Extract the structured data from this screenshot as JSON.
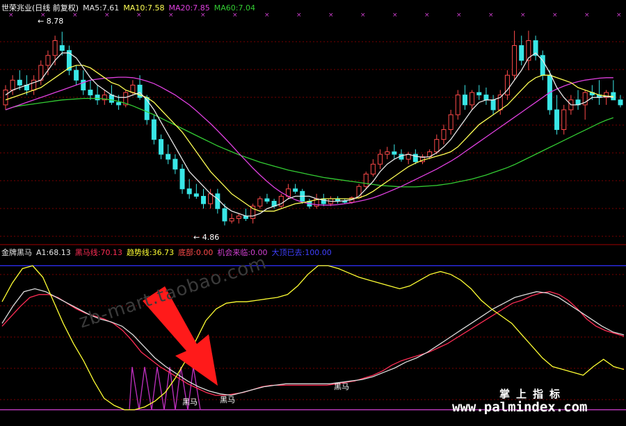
{
  "colors": {
    "up": "#ff4a4a",
    "down": "#39e6e6",
    "ma5": "#e8e8e8",
    "ma10": "#ffff55",
    "ma20": "#e040e0",
    "ma60": "#33cc33",
    "grid": "#7a0000",
    "red": "#ff2d55",
    "white": "#dddddd",
    "yellow": "#ffff33",
    "magenta": "#d040d0",
    "blue": "#3030ff"
  },
  "header": {
    "title": "世荣兆业(日线 前复权)",
    "ma5": "MA5:7.61",
    "ma10": "MA10:7.58",
    "ma20": "MA20:7.85",
    "ma60": "MA60:7.04"
  },
  "price_labels": {
    "high": "8.78",
    "low": "4.86"
  },
  "indicator": {
    "name": "金牌黑马",
    "a1": "A1:68.13",
    "heima_line": "黑马线:70.13",
    "trend_line": "趋势线:36.73",
    "bottom": "底部:0.00",
    "chance": "机会来临:0.00",
    "top_passed": "大顶已去:100.00"
  },
  "signals": {
    "s1": "黑马",
    "s2": "黑马",
    "s3": "黑马"
  },
  "watermark": "zb-mart.taobao.com",
  "brand": {
    "cn": "掌上指标",
    "url": "www.palmindex.com"
  },
  "chart_data": [
    {
      "type": "candlestick",
      "title": "世荣兆业(日线 前复权)",
      "ohlc": [
        [
          7.3,
          7.7,
          7.2,
          7.6
        ],
        [
          7.6,
          7.9,
          7.5,
          7.8
        ],
        [
          7.8,
          8.0,
          7.6,
          7.7
        ],
        [
          7.7,
          7.9,
          7.5,
          7.6
        ],
        [
          7.6,
          7.9,
          7.5,
          7.8
        ],
        [
          7.8,
          8.2,
          7.7,
          8.1
        ],
        [
          8.1,
          8.4,
          7.9,
          8.3
        ],
        [
          8.3,
          8.7,
          8.1,
          8.6
        ],
        [
          8.5,
          8.78,
          8.3,
          8.4
        ],
        [
          8.4,
          8.5,
          7.9,
          8.0
        ],
        [
          8.0,
          8.1,
          7.7,
          7.8
        ],
        [
          7.8,
          8.0,
          7.5,
          7.6
        ],
        [
          7.6,
          7.8,
          7.4,
          7.5
        ],
        [
          7.5,
          7.7,
          7.3,
          7.4
        ],
        [
          7.4,
          7.6,
          7.3,
          7.5
        ],
        [
          7.5,
          7.7,
          7.3,
          7.35
        ],
        [
          7.35,
          7.5,
          7.2,
          7.3
        ],
        [
          7.3,
          7.6,
          7.25,
          7.55
        ],
        [
          7.55,
          7.8,
          7.5,
          7.7
        ],
        [
          7.7,
          7.9,
          7.4,
          7.45
        ],
        [
          7.45,
          7.5,
          6.9,
          7.0
        ],
        [
          7.0,
          7.1,
          6.5,
          6.6
        ],
        [
          6.6,
          6.7,
          6.2,
          6.3
        ],
        [
          6.3,
          6.5,
          6.1,
          6.2
        ],
        [
          6.2,
          6.3,
          5.9,
          6.0
        ],
        [
          6.0,
          6.1,
          5.5,
          5.6
        ],
        [
          5.6,
          5.8,
          5.4,
          5.5
        ],
        [
          5.5,
          5.7,
          5.4,
          5.45
        ],
        [
          5.45,
          5.6,
          5.2,
          5.3
        ],
        [
          5.3,
          5.6,
          5.2,
          5.5
        ],
        [
          5.5,
          5.6,
          5.1,
          5.2
        ],
        [
          5.2,
          5.3,
          4.86,
          4.95
        ],
        [
          4.95,
          5.1,
          4.9,
          5.0
        ],
        [
          5.0,
          5.1,
          4.9,
          5.05
        ],
        [
          5.05,
          5.2,
          4.95,
          5.0
        ],
        [
          5.0,
          5.3,
          4.9,
          5.25
        ],
        [
          5.25,
          5.45,
          5.2,
          5.4
        ],
        [
          5.4,
          5.5,
          5.3,
          5.35
        ],
        [
          5.35,
          5.4,
          5.2,
          5.25
        ],
        [
          5.25,
          5.5,
          5.2,
          5.45
        ],
        [
          5.45,
          5.7,
          5.4,
          5.6
        ],
        [
          5.6,
          5.7,
          5.5,
          5.55
        ],
        [
          5.55,
          5.6,
          5.3,
          5.35
        ],
        [
          5.35,
          5.4,
          5.2,
          5.25
        ],
        [
          5.25,
          5.5,
          5.2,
          5.4
        ],
        [
          5.4,
          5.5,
          5.25,
          5.3
        ],
        [
          5.3,
          5.45,
          5.25,
          5.4
        ],
        [
          5.4,
          5.45,
          5.3,
          5.35
        ],
        [
          5.35,
          5.4,
          5.3,
          5.33
        ],
        [
          5.33,
          5.45,
          5.3,
          5.42
        ],
        [
          5.42,
          5.7,
          5.4,
          5.65
        ],
        [
          5.65,
          5.95,
          5.6,
          5.9
        ],
        [
          5.9,
          6.2,
          5.85,
          6.1
        ],
        [
          6.1,
          6.4,
          6.0,
          6.3
        ],
        [
          6.3,
          6.45,
          6.2,
          6.35
        ],
        [
          6.35,
          6.5,
          6.2,
          6.3
        ],
        [
          6.3,
          6.4,
          6.15,
          6.2
        ],
        [
          6.2,
          6.35,
          6.1,
          6.3
        ],
        [
          6.3,
          6.4,
          6.1,
          6.15
        ],
        [
          6.15,
          6.3,
          6.1,
          6.25
        ],
        [
          6.25,
          6.4,
          6.2,
          6.35
        ],
        [
          6.35,
          6.7,
          6.3,
          6.6
        ],
        [
          6.6,
          6.9,
          6.5,
          6.8
        ],
        [
          6.8,
          7.2,
          6.7,
          7.1
        ],
        [
          7.1,
          7.6,
          7.0,
          7.5
        ],
        [
          7.5,
          7.7,
          7.2,
          7.3
        ],
        [
          7.3,
          7.6,
          7.2,
          7.55
        ],
        [
          7.55,
          7.7,
          7.4,
          7.5
        ],
        [
          7.5,
          7.65,
          7.3,
          7.4
        ],
        [
          7.4,
          7.5,
          7.1,
          7.2
        ],
        [
          7.2,
          7.6,
          7.1,
          7.5
        ],
        [
          7.5,
          8.0,
          7.4,
          7.9
        ],
        [
          7.9,
          8.8,
          7.8,
          8.5
        ],
        [
          8.5,
          8.7,
          8.1,
          8.2
        ],
        [
          8.2,
          8.8,
          8.0,
          8.6
        ],
        [
          8.6,
          8.7,
          8.2,
          8.3
        ],
        [
          8.3,
          8.4,
          7.8,
          7.9
        ],
        [
          7.9,
          8.0,
          7.1,
          7.2
        ],
        [
          7.2,
          7.5,
          6.7,
          6.8
        ],
        [
          6.8,
          7.3,
          6.7,
          7.2
        ],
        [
          7.2,
          7.5,
          7.1,
          7.4
        ],
        [
          7.4,
          7.6,
          7.2,
          7.3
        ],
        [
          7.3,
          7.6,
          7.0,
          7.55
        ],
        [
          7.55,
          7.7,
          7.4,
          7.5
        ],
        [
          7.5,
          7.8,
          7.3,
          7.45
        ],
        [
          7.45,
          7.6,
          7.3,
          7.55
        ],
        [
          7.55,
          7.8,
          7.4,
          7.4
        ],
        [
          7.4,
          7.5,
          7.25,
          7.3
        ]
      ],
      "ma5": [
        7.5,
        7.6,
        7.65,
        7.7,
        7.75,
        7.8,
        8.0,
        8.2,
        8.35,
        8.35,
        8.25,
        8.05,
        7.85,
        7.7,
        7.6,
        7.5,
        7.45,
        7.45,
        7.5,
        7.55,
        7.4,
        7.2,
        6.95,
        6.7,
        6.45,
        6.2,
        5.95,
        5.8,
        5.65,
        5.5,
        5.4,
        5.25,
        5.15,
        5.1,
        5.05,
        5.05,
        5.1,
        5.2,
        5.25,
        5.3,
        5.4,
        5.45,
        5.45,
        5.45,
        5.4,
        5.37,
        5.35,
        5.35,
        5.36,
        5.38,
        5.45,
        5.6,
        5.75,
        5.95,
        6.1,
        6.2,
        6.27,
        6.3,
        6.26,
        6.24,
        6.25,
        6.33,
        6.45,
        6.6,
        6.8,
        7.0,
        7.2,
        7.35,
        7.4,
        7.4,
        7.45,
        7.6,
        7.8,
        8.0,
        8.25,
        8.35,
        8.2,
        7.95,
        7.65,
        7.45,
        7.3,
        7.3,
        7.35,
        7.45,
        7.45,
        7.47,
        7.45
      ],
      "ma10": [
        7.4,
        7.45,
        7.5,
        7.55,
        7.6,
        7.65,
        7.75,
        7.85,
        7.95,
        8.05,
        8.1,
        8.1,
        8.05,
        7.95,
        7.85,
        7.75,
        7.7,
        7.6,
        7.55,
        7.5,
        7.45,
        7.35,
        7.2,
        7.05,
        6.9,
        6.75,
        6.55,
        6.35,
        6.15,
        5.95,
        5.8,
        5.65,
        5.5,
        5.4,
        5.3,
        5.2,
        5.15,
        5.15,
        5.15,
        5.2,
        5.25,
        5.3,
        5.32,
        5.35,
        5.38,
        5.4,
        5.4,
        5.4,
        5.4,
        5.4,
        5.42,
        5.47,
        5.55,
        5.65,
        5.75,
        5.85,
        5.95,
        6.05,
        6.12,
        6.18,
        6.22,
        6.26,
        6.3,
        6.35,
        6.45,
        6.6,
        6.75,
        6.9,
        7.0,
        7.1,
        7.2,
        7.3,
        7.45,
        7.6,
        7.75,
        7.85,
        7.9,
        7.9,
        7.85,
        7.8,
        7.75,
        7.65,
        7.6,
        7.55,
        7.5,
        7.48,
        7.47
      ],
      "ma20": [
        7.2,
        7.25,
        7.3,
        7.35,
        7.4,
        7.45,
        7.5,
        7.55,
        7.6,
        7.65,
        7.7,
        7.75,
        7.8,
        7.82,
        7.84,
        7.85,
        7.86,
        7.86,
        7.85,
        7.82,
        7.78,
        7.73,
        7.66,
        7.58,
        7.5,
        7.4,
        7.3,
        7.18,
        7.05,
        6.92,
        6.78,
        6.63,
        6.48,
        6.32,
        6.17,
        6.02,
        5.88,
        5.75,
        5.63,
        5.53,
        5.45,
        5.38,
        5.33,
        5.3,
        5.28,
        5.27,
        5.27,
        5.28,
        5.3,
        5.32,
        5.35,
        5.38,
        5.42,
        5.47,
        5.53,
        5.59,
        5.65,
        5.72,
        5.79,
        5.86,
        5.93,
        6.0,
        6.08,
        6.16,
        6.25,
        6.35,
        6.45,
        6.55,
        6.65,
        6.75,
        6.85,
        6.95,
        7.05,
        7.15,
        7.25,
        7.35,
        7.45,
        7.55,
        7.62,
        7.68,
        7.73,
        7.77,
        7.8,
        7.82,
        7.84,
        7.85,
        7.85
      ],
      "ma60": [
        7.2,
        7.25,
        7.28,
        7.3,
        7.32,
        7.34,
        7.36,
        7.38,
        7.4,
        7.41,
        7.42,
        7.43,
        7.43,
        7.43,
        7.42,
        7.4,
        7.37,
        7.33,
        7.28,
        7.22,
        7.16,
        7.1,
        7.03,
        6.96,
        6.89,
        6.82,
        6.75,
        6.68,
        6.61,
        6.54,
        6.47,
        6.41,
        6.35,
        6.29,
        6.24,
        6.19,
        6.14,
        6.1,
        6.06,
        6.02,
        5.98,
        5.95,
        5.92,
        5.89,
        5.86,
        5.83,
        5.81,
        5.79,
        5.77,
        5.75,
        5.73,
        5.71,
        5.69,
        5.67,
        5.66,
        5.65,
        5.64,
        5.64,
        5.64,
        5.65,
        5.66,
        5.67,
        5.69,
        5.71,
        5.74,
        5.77,
        5.8,
        5.84,
        5.88,
        5.93,
        5.98,
        6.03,
        6.09,
        6.16,
        6.23,
        6.3,
        6.37,
        6.44,
        6.51,
        6.58,
        6.65,
        6.72,
        6.79,
        6.86,
        6.93,
        6.99,
        7.04
      ],
      "ylim": [
        4.5,
        9.0
      ]
    },
    {
      "type": "line",
      "title": "金牌黑马",
      "ylim": [
        -5,
        105
      ],
      "series": [
        {
          "name": "黑马线",
          "values": [
            58,
            65,
            72,
            78,
            80,
            80,
            78,
            74,
            70,
            67,
            65,
            63,
            60,
            55,
            48,
            40,
            35,
            30,
            26,
            22,
            18,
            15,
            12,
            10,
            10,
            11,
            12,
            14,
            16,
            17,
            17,
            17,
            17,
            17,
            17,
            17,
            18,
            19,
            20,
            22,
            24,
            27,
            31,
            34,
            36,
            38,
            40,
            43,
            46,
            50,
            54,
            58,
            62,
            66,
            70,
            74,
            76,
            79,
            81,
            82,
            80,
            76,
            70,
            63,
            58,
            55,
            53,
            51
          ]
        },
        {
          "name": "A1",
          "values": [
            60,
            72,
            82,
            84,
            82,
            78,
            74,
            70,
            66,
            63,
            61,
            58,
            52,
            44,
            36,
            30,
            25,
            20,
            16,
            13,
            11,
            10,
            12,
            14,
            16,
            17,
            18,
            18,
            18,
            18,
            18,
            19,
            20,
            21,
            23,
            26,
            29,
            33,
            36,
            40,
            45,
            50,
            55,
            60,
            65,
            70,
            74,
            78,
            80,
            82,
            81,
            78,
            73,
            68,
            63,
            58,
            54,
            52
          ]
        },
        {
          "name": "趋势线",
          "values": [
            75,
            88,
            98,
            100,
            92,
            76,
            60,
            46,
            34,
            20,
            8,
            3,
            0,
            0,
            2,
            6,
            12,
            22,
            34,
            48,
            62,
            70,
            74,
            75,
            75,
            76,
            77,
            78,
            80,
            86,
            94,
            100,
            100,
            98,
            95,
            92,
            90,
            88,
            86,
            84,
            86,
            90,
            94,
            96,
            94,
            90,
            84,
            76,
            70,
            65,
            60,
            52,
            44,
            36,
            30,
            28,
            26,
            24,
            30,
            35,
            30,
            28
          ]
        }
      ]
    }
  ]
}
